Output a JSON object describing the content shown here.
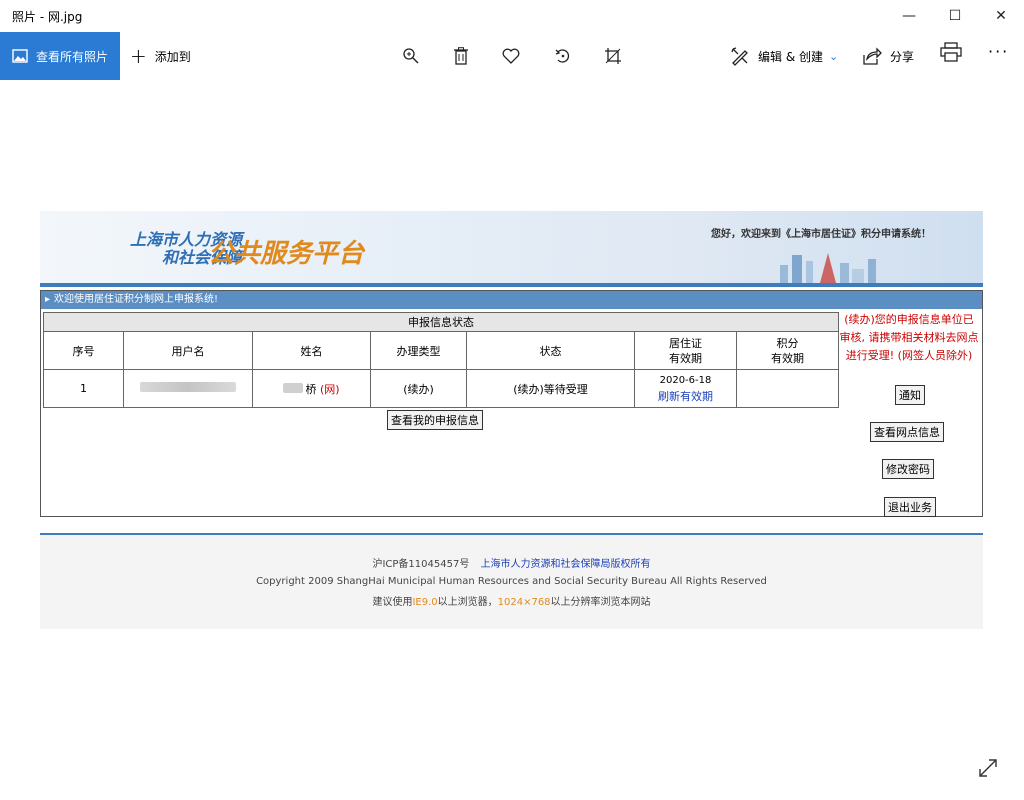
{
  "window": {
    "title": "照片 - 网.jpg"
  },
  "toolbar": {
    "view_all": "查看所有照片",
    "add_to": "添加到",
    "edit_create": "编辑 & 创建",
    "share": "分享"
  },
  "site": {
    "logo_line1": "上海市人力资源",
    "logo_line2": "和社会保障",
    "logo_main": "公共服务平台",
    "welcome": "您好，欢迎来到《上海市居住证》积分申请系统！",
    "bar": "欢迎使用居住证积分制网上申报系统!",
    "table_title": "申报信息状态",
    "headers": [
      "序号",
      "用户名",
      "姓名",
      "办理类型",
      "状态",
      "居住证",
      "有效期",
      "积分",
      "有效期"
    ],
    "row": {
      "index": "1",
      "name_tail": "桥",
      "name_tag": "(网)",
      "type": "(续办)",
      "status": "(续办)等待受理",
      "permit_date": "2020-6-18",
      "refresh": "刷新有效期"
    },
    "my_info_btn": "查看我的申报信息",
    "side_note": "(续办)您的申报信息单位已审核, 请携带相关材料去网点进行受理! (网签人员除外)",
    "side_buttons": [
      "通知",
      "查看网点信息",
      "修改密码",
      "退出业务"
    ],
    "footer": {
      "icp": "沪ICP备11045457号",
      "copyright_cn": "上海市人力资源和社会保障局版权所有",
      "copyright_en": "Copyright 2009 ShangHai Municipal Human Resources and Social Security Bureau All Rights Reserved",
      "suggest_pre": "建议使用",
      "ie": "IE9.0",
      "suggest_mid": "以上浏览器，",
      "res": "1024×768",
      "suggest_post": "以上分辨率浏览本网站"
    }
  }
}
